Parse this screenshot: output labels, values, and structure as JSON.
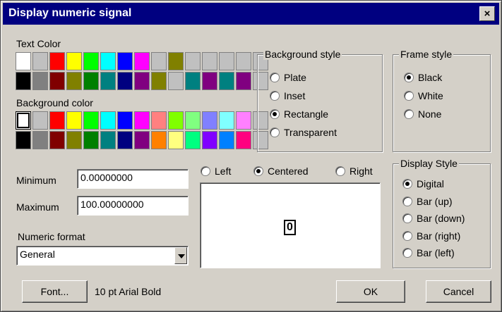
{
  "window": {
    "title": "Display numeric signal",
    "close": "×"
  },
  "text_color": {
    "label": "Text Color",
    "row1": [
      "#ffffff",
      "#c0c0c0",
      "#ff0000",
      "#ffff00",
      "#00ff00",
      "#00ffff",
      "#0000ff",
      "#ff00ff",
      "#c0c0c0",
      "#808000",
      "#c0c0c0",
      "#c0c0c0",
      "#c0c0c0",
      "#c0c0c0",
      "#c0c0c0"
    ],
    "row2": [
      "#000000",
      "#808080",
      "#800000",
      "#808000",
      "#008000",
      "#008080",
      "#000080",
      "#800080",
      "#808000",
      "#c0c0c0",
      "#008080",
      "#800080",
      "#008080",
      "#800080",
      "#c0c0c0"
    ]
  },
  "background_color": {
    "label": "Background color",
    "row1": [
      "#ffffff",
      "#c0c0c0",
      "#ff0000",
      "#ffff00",
      "#00ff00",
      "#00ffff",
      "#0000ff",
      "#ff00ff",
      "#ff8080",
      "#80ff00",
      "#80ff80",
      "#8080ff",
      "#80ffff",
      "#ff80ff",
      "#c0c0c0"
    ],
    "row2": [
      "#000000",
      "#808080",
      "#800000",
      "#808000",
      "#008000",
      "#008080",
      "#000080",
      "#800080",
      "#ff8000",
      "#ffff80",
      "#00ff80",
      "#8000ff",
      "#0080ff",
      "#ff0080",
      "#c0c0c0"
    ],
    "selected_index": 0
  },
  "background_style": {
    "label": "Background style",
    "options": [
      "Plate",
      "Inset",
      "Rectangle",
      "Transparent"
    ],
    "selected": "Rectangle"
  },
  "frame_style": {
    "label": "Frame style",
    "options": [
      "Black",
      "White",
      "None"
    ],
    "selected": "Black"
  },
  "range": {
    "min_label": "Minimum",
    "min_value": "0.00000000",
    "max_label": "Maximum",
    "max_value": "100.00000000"
  },
  "alignment": {
    "options": [
      "Left",
      "Centered",
      "Right"
    ],
    "selected": "Centered"
  },
  "preview_value": "0",
  "numeric_format": {
    "label": "Numeric format",
    "value": "General"
  },
  "display_style": {
    "label": "Display Style",
    "options": [
      "Digital",
      "Bar (up)",
      "Bar (down)",
      "Bar (right)",
      "Bar (left)"
    ],
    "selected": "Digital"
  },
  "font": {
    "button": "Font...",
    "description": "10 pt Arial Bold"
  },
  "buttons": {
    "ok": "OK",
    "cancel": "Cancel"
  }
}
